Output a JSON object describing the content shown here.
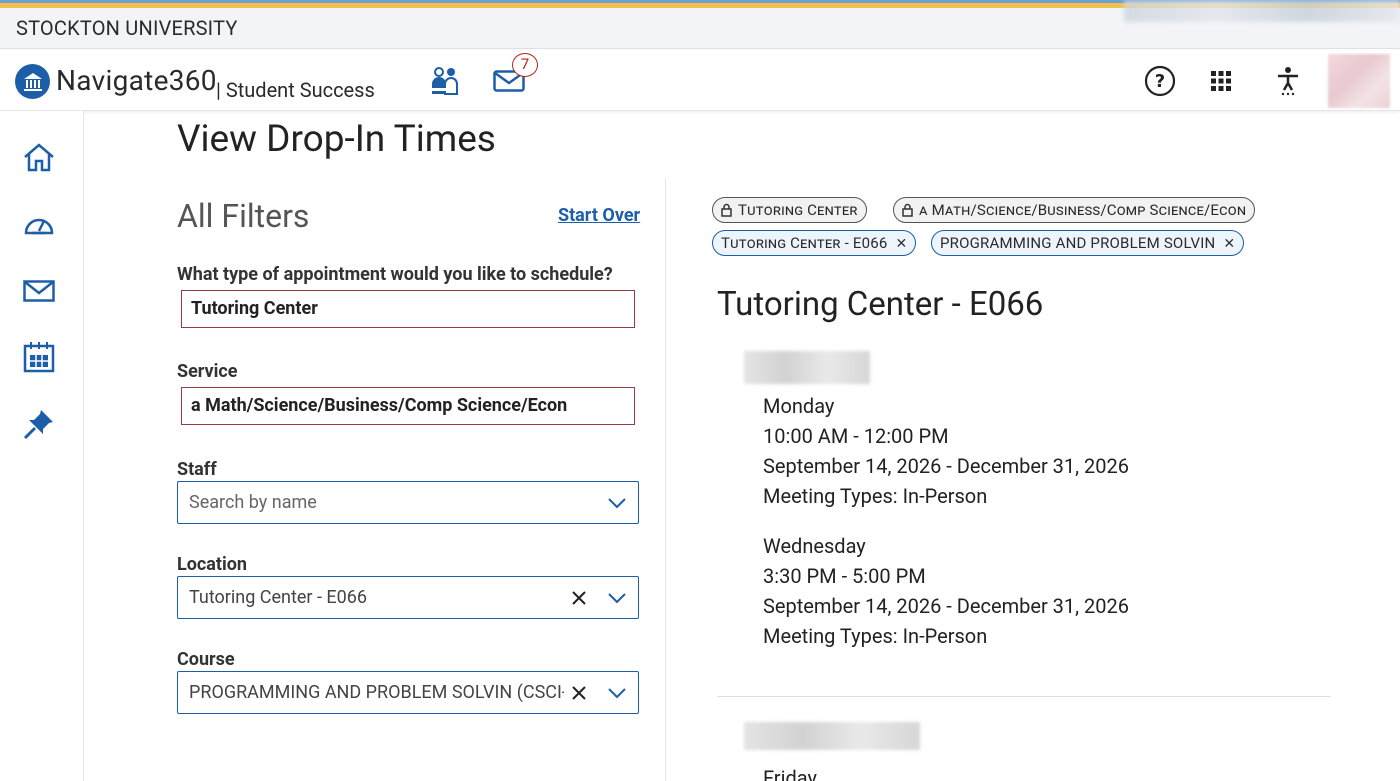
{
  "university": {
    "name": "STOCKTON UNIVERSITY"
  },
  "header": {
    "brand": "Navigate360",
    "sub_brand": "| Student Success",
    "mail_count": "7",
    "icons": [
      "people-icon",
      "mail-icon",
      "help-icon",
      "apps-grid-icon",
      "accessibility-icon"
    ]
  },
  "sidebar": {
    "items": [
      {
        "icon": "home-icon"
      },
      {
        "icon": "dashboard-gauge-icon"
      },
      {
        "icon": "mail-icon"
      },
      {
        "icon": "calendar-icon"
      },
      {
        "icon": "pin-icon"
      }
    ]
  },
  "page": {
    "title": "View Drop-In Times"
  },
  "filters": {
    "title": "All Filters",
    "start_over": "Start Over",
    "appointment_type": {
      "label": "What type of appointment would you like to schedule?",
      "value": "Tutoring Center"
    },
    "service": {
      "label": "Service",
      "value": "a Math/Science/Business/Comp Science/Econ"
    },
    "staff": {
      "label": "Staff",
      "placeholder": "Search by name"
    },
    "location": {
      "label": "Location",
      "value": "Tutoring Center - E066"
    },
    "course": {
      "label": "Course",
      "value": "PROGRAMMING AND PROBLEM SOLVIN (CSCI-"
    }
  },
  "chips": [
    {
      "label": "Tutoring Center",
      "locked": true
    },
    {
      "label": "a Math/Science/Business/Comp Science/Econ",
      "locked": true
    },
    {
      "label": "Tutoring Center - E066",
      "removable": true
    },
    {
      "label": "PROGRAMMING AND PROBLEM SOLVIN",
      "removable": true
    }
  ],
  "results": {
    "title": "Tutoring Center - E066",
    "slots": [
      {
        "day": "Monday",
        "time": "10:00 AM - 12:00 PM",
        "dates": "September 14, 2026 - December 31, 2026",
        "meeting": "Meeting Types: In-Person"
      },
      {
        "day": "Wednesday",
        "time": "3:30 PM - 5:00 PM",
        "dates": "September 14, 2026 - December 31, 2026",
        "meeting": "Meeting Types: In-Person"
      },
      {
        "day": "Friday"
      }
    ]
  },
  "colors": {
    "brand_blue": "#1d5ea8",
    "required_border": "#9b3a45",
    "badge_red": "#b3261e"
  }
}
